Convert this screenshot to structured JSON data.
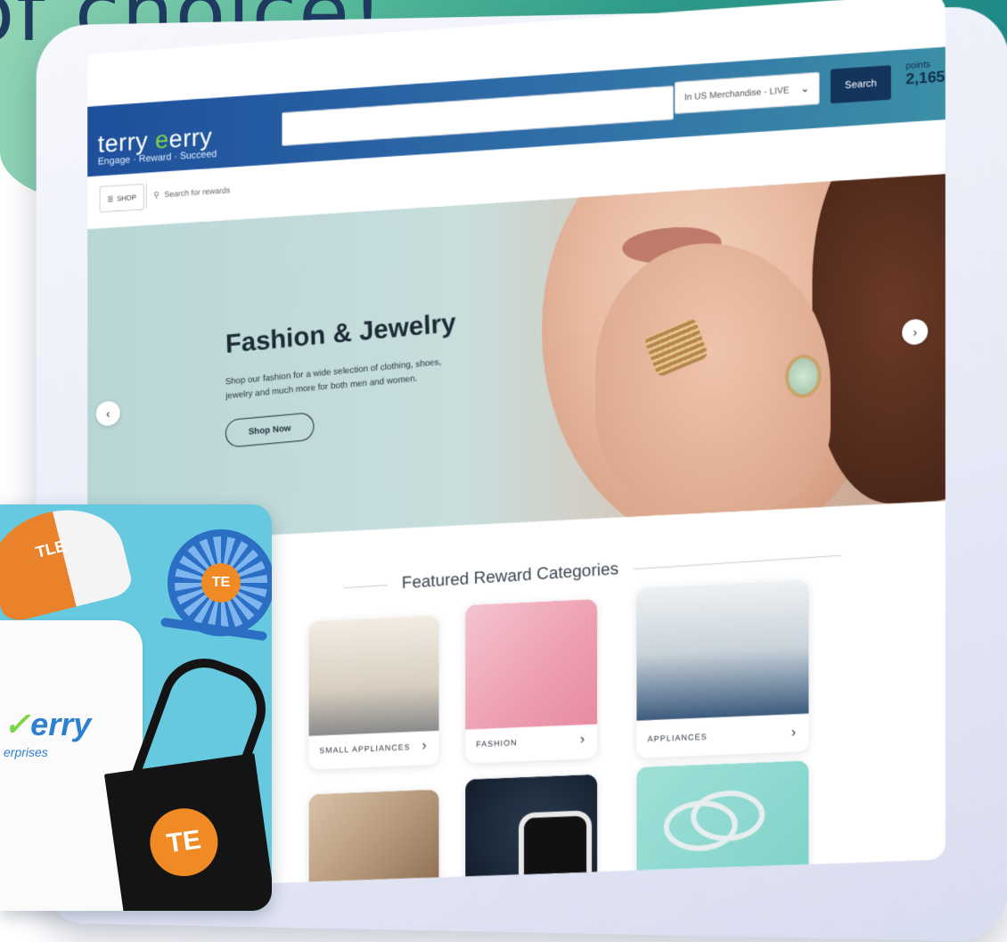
{
  "marketing": {
    "headline": "of choice!"
  },
  "header": {
    "logo_main": "terry",
    "logo_accent": "erry",
    "tagline": "Engage · Reward · Succeed",
    "catalog_select": "In US Merchandise - LIVE",
    "search_button": "Search",
    "points_label": "points",
    "points_value": "2,165"
  },
  "toolbar": {
    "shop_label": "SHOP",
    "search_placeholder": "Search for rewards"
  },
  "hero": {
    "title": "Fashion & Jewelry",
    "description": "Shop our fashion for a wide selection of clothing, shoes, jewelry and much more for both men and women.",
    "cta": "Shop Now"
  },
  "featured": {
    "title": "Featured Reward Categories",
    "categories": [
      {
        "label": "SMALL APPLIANCES"
      },
      {
        "label": "FASHION"
      },
      {
        "label": "APPLIANCES"
      },
      {
        "label": ""
      },
      {
        "label": ""
      },
      {
        "label": ""
      }
    ]
  },
  "promo": {
    "hat_text": "TLE",
    "shirt_brand_main": "erry",
    "shirt_brand_sub": "erprises",
    "fan_logo": "TE",
    "tote_logo": "TE"
  },
  "icons": {
    "menu": "menu-icon",
    "search": "search-icon",
    "chevron_down": "chevron-down-icon",
    "chevron_left": "chevron-left-icon",
    "chevron_right": "chevron-right-icon"
  },
  "colors": {
    "header_blue": "#1e4f9b",
    "header_teal": "#3b8fa6",
    "search_button_navy": "#13345b",
    "logo_green": "#7cd54a",
    "brand_orange": "#ef8a25",
    "promo_bg": "#66c9df"
  }
}
